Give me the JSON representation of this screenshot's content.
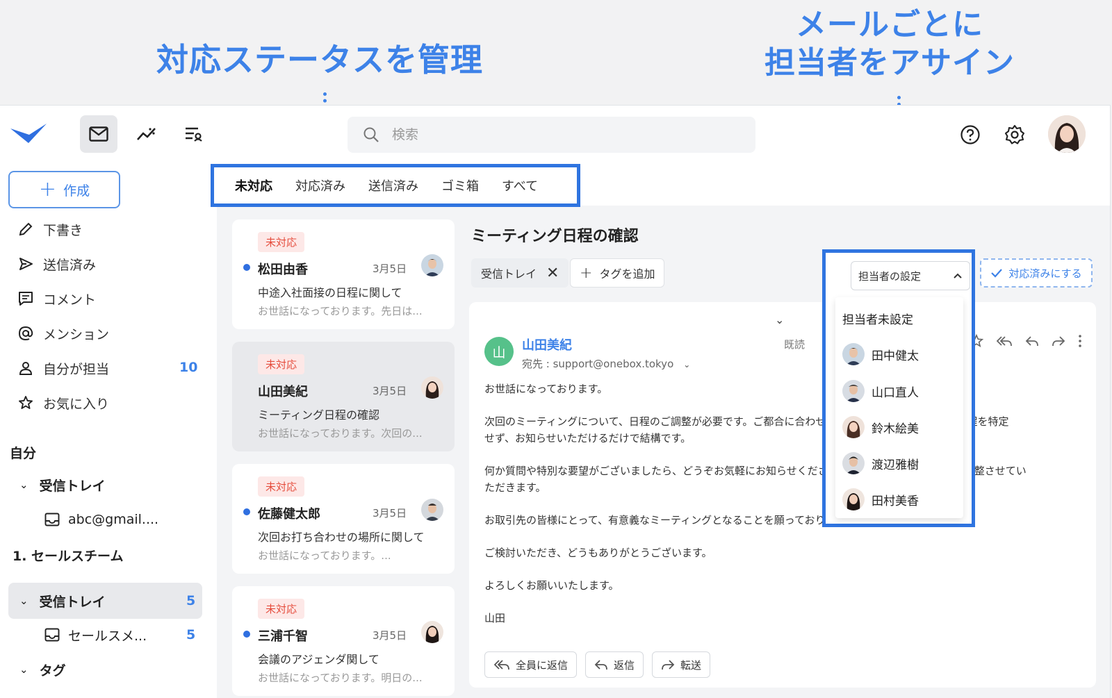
{
  "callouts": {
    "status": "対応ステータスを管理",
    "assign_line1": "メールごとに",
    "assign_line2": "担当者をアサイン"
  },
  "header": {
    "search_placeholder": "検索"
  },
  "sidebar": {
    "compose_label": "作成",
    "items": [
      {
        "label": "下書き",
        "icon": "pencil-icon"
      },
      {
        "label": "送信済み",
        "icon": "send-icon"
      },
      {
        "label": "コメント",
        "icon": "comment-icon"
      },
      {
        "label": "メンション",
        "icon": "at-icon"
      },
      {
        "label": "自分が担当",
        "icon": "person-icon",
        "count": "10"
      },
      {
        "label": "お気に入り",
        "icon": "star-icon"
      }
    ],
    "section_self": "自分",
    "self_inbox": "受信トレイ",
    "self_account": "abc@gmail....",
    "section_team": "1. セールスチーム",
    "team_inbox": "受信トレイ",
    "team_inbox_count": "5",
    "team_account": "セールスメ...",
    "team_account_count": "5",
    "tags_label": "タグ"
  },
  "tabs": [
    "未対応",
    "対応済み",
    "送信済み",
    "ゴミ箱",
    "すべて"
  ],
  "messages": [
    {
      "status": "未対応",
      "sender": "松田由香",
      "date": "3月5日",
      "subject": "中途入社面接の日程に関して",
      "preview": "お世話になっております。先日は...",
      "unread": true
    },
    {
      "status": "未対応",
      "sender": "山田美紀",
      "date": "3月5日",
      "subject": "ミーティング日程の確認",
      "preview": "お世話になっております。次回の...",
      "unread": false
    },
    {
      "status": "未対応",
      "sender": "佐藤健太郎",
      "date": "3月5日",
      "subject": "次回お打ち合わせの場所に関して",
      "preview": "お世話になっております。...",
      "unread": true
    },
    {
      "status": "未対応",
      "sender": "三浦千智",
      "date": "3月5日",
      "subject": "会議のアジェンダ関して",
      "preview": "お世話になっております。明日の...",
      "unread": true
    }
  ],
  "detail": {
    "title": "ミーティング日程の確認",
    "inbox_chip": "受信トレイ",
    "add_tag": "タグを追加",
    "resolve": "対応済みにする",
    "sender_initial": "山",
    "sender_name": "山田美紀",
    "to": "宛先 : support@onebox.tokyo",
    "read": "既読",
    "body": [
      "お世話になっております。",
      "次回のミーティングについて、日程のご調整が必要です。ご都合に合わせていただけますでしょうか?日程を特定\nせず、お知らせいただけるだけで結構です。",
      "何か質問や特別な要望がございましたら、どうぞお気軽にお知らせください。皆様のご都合に合わせて調整させてい\nただきます。",
      "お取引先の皆様にとって、有意義なミーティングとなることを願っております。",
      "ご検討いただき、どうもありがとうございます。",
      "よろしくお願いいたします。",
      "山田"
    ],
    "reply_all": "全員に返信",
    "reply": "返信",
    "forward": "転送"
  },
  "assignee": {
    "select_label": "担当者の設定",
    "unassigned": "担当者未設定",
    "options": [
      "田中健太",
      "山口直人",
      "鈴木絵美",
      "渡辺雅樹",
      "田村美香"
    ]
  },
  "colors": {
    "accent": "#3d82e8",
    "highlight_border": "#2f74e0",
    "status_red": "#e54c3c",
    "status_bg": "#fde8e7"
  }
}
